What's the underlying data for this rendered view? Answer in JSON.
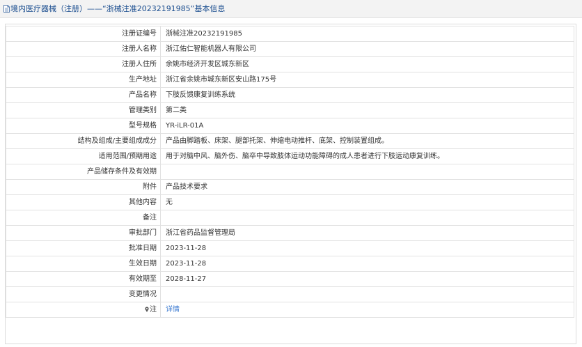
{
  "header": {
    "title": "境内医疗器械（注册）——“浙械注准20232191985”基本信息"
  },
  "colors": {
    "accent": "#1a4d8f",
    "link": "#3b7ad0",
    "border": "#e1e1e1"
  },
  "rows": [
    {
      "label": "注册证编号",
      "value": "浙械注准20232191985"
    },
    {
      "label": "注册人名称",
      "value": "浙江佑仁智能机器人有限公司"
    },
    {
      "label": "注册人住所",
      "value": "余姚市经济开发区城东新区"
    },
    {
      "label": "生产地址",
      "value": "浙江省余姚市城东新区安山路175号"
    },
    {
      "label": "产品名称",
      "value": "下肢反馈康复训练系统"
    },
    {
      "label": "管理类别",
      "value": "第二类"
    },
    {
      "label": "型号规格",
      "value": "YR-iLR-01A"
    },
    {
      "label": "结构及组成/主要组成成分",
      "value": "产品由脚踏板、床架、腿部托架、伸缩电动推杆、底架、控制装置组成。"
    },
    {
      "label": "适用范围/预期用途",
      "value": "用于对脑中风、脑外伤、脑卒中导致肢体运动功能障碍的成人患者进行下肢运动康复训练。"
    },
    {
      "label": "产品储存条件及有效期",
      "value": ""
    },
    {
      "label": "附件",
      "value": "产品技术要求"
    },
    {
      "label": "其他内容",
      "value": "无"
    },
    {
      "label": "备注",
      "value": ""
    },
    {
      "label": "审批部门",
      "value": "浙江省药品监督管理局"
    },
    {
      "label": "批准日期",
      "value": "2023-11-28"
    },
    {
      "label": "生效日期",
      "value": "2023-11-28"
    },
    {
      "label": "有效期至",
      "value": "2028-11-27"
    },
    {
      "label": "变更情况",
      "value": ""
    }
  ],
  "note": {
    "label": "注",
    "icon": "note-pin-icon",
    "link_text": "详情"
  }
}
